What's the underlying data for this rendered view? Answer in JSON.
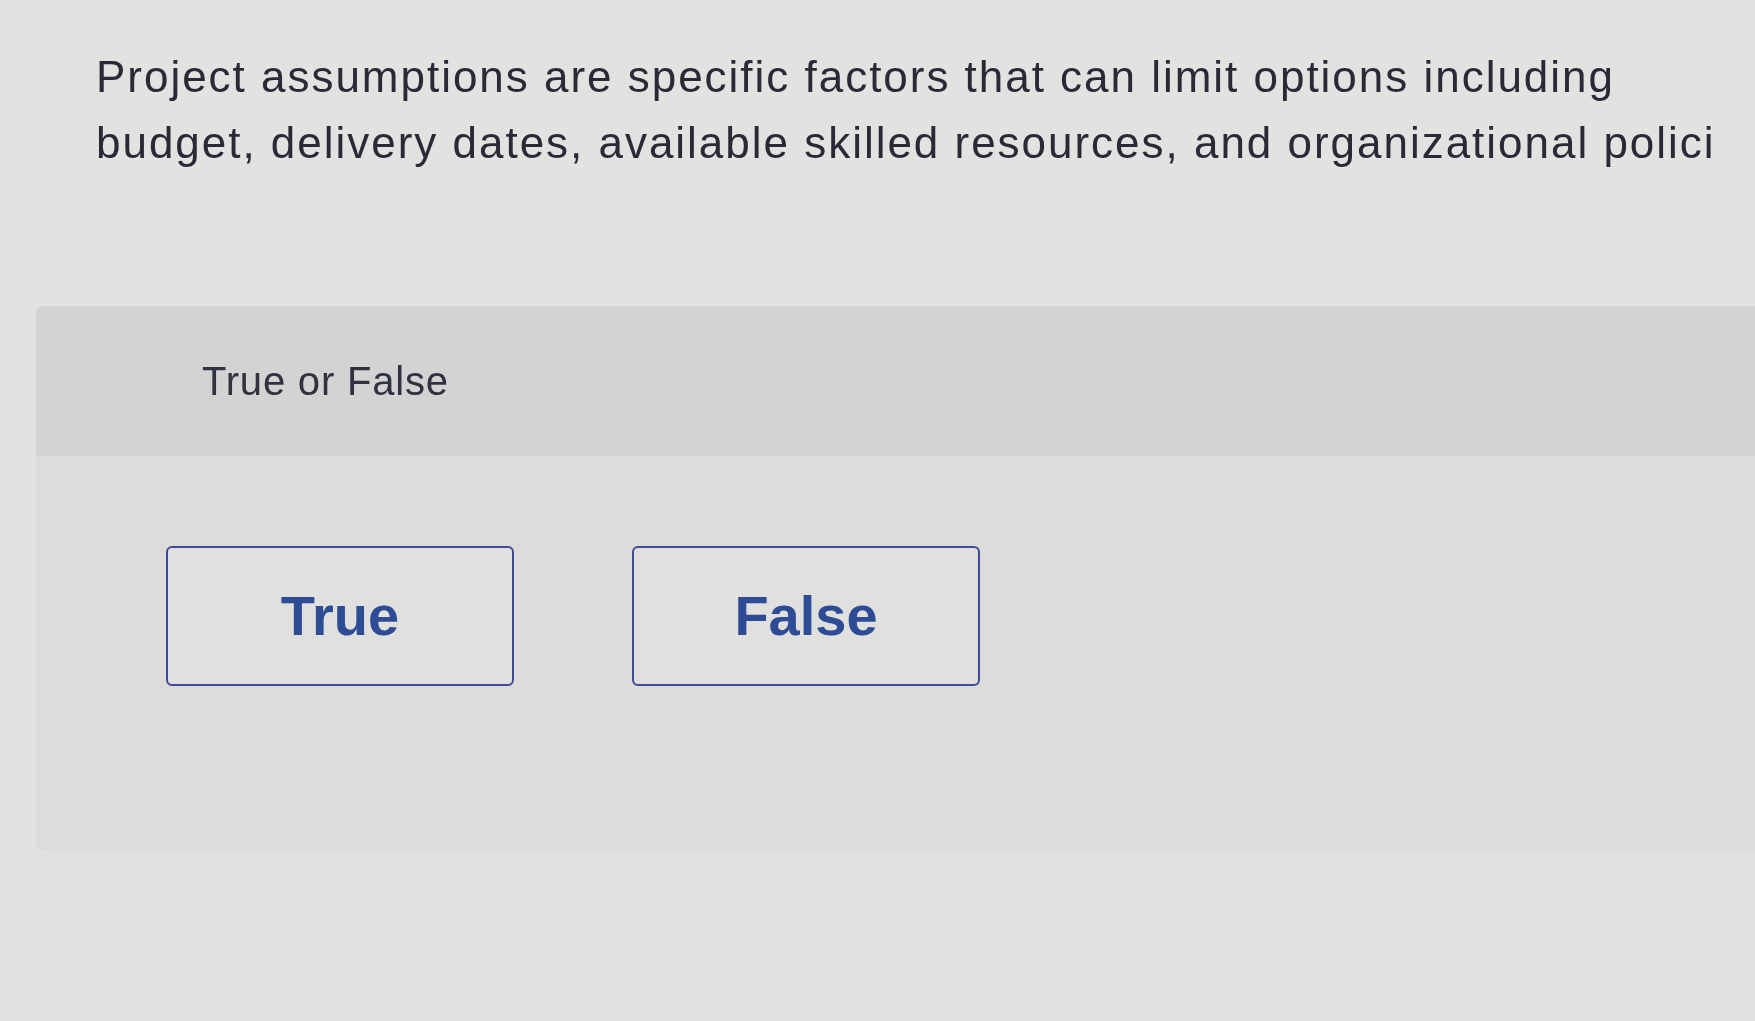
{
  "question": {
    "text": "Project assumptions are specific factors that can limit options including\nbudget, delivery dates, available skilled resources, and organizational polici"
  },
  "prompt": {
    "label": "True or False"
  },
  "options": [
    {
      "label": "True"
    },
    {
      "label": "False"
    }
  ]
}
